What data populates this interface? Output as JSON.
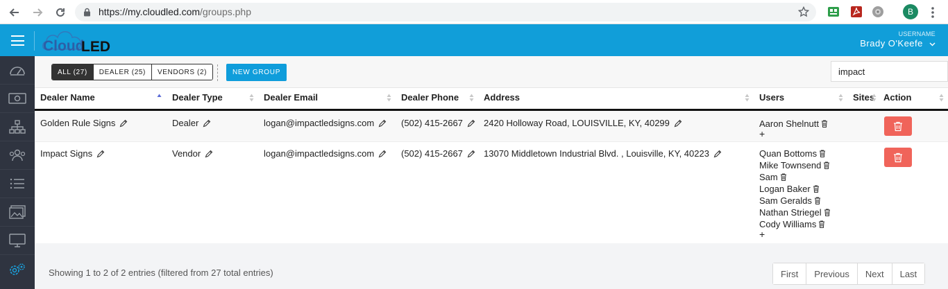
{
  "browser": {
    "url_host": "https://my.cloudled.com",
    "url_path": "/groups.php",
    "avatar_letter": "B"
  },
  "header": {
    "logo_cloud": "Cloud",
    "logo_led": "LED",
    "user_label": "USERNAME",
    "user_name": "Brady O'Keefe",
    "accent": "#119ed9"
  },
  "sidebar": {
    "items": [
      "dashboard-icon",
      "money-icon",
      "hierarchy-icon",
      "users-icon",
      "list-icon",
      "media-icon",
      "monitor-icon",
      "settings-icon"
    ]
  },
  "toolbar": {
    "filters": [
      "ALL (27)",
      "DEALER (25)",
      "VENDORS (2)"
    ],
    "new_group_label": "NEW GROUP",
    "search_value": "impact"
  },
  "table": {
    "headers": [
      "Dealer Name",
      "Dealer Type",
      "Dealer Email",
      "Dealer Phone",
      "Address",
      "Users",
      "Sites",
      "Action"
    ],
    "rows": [
      {
        "name": "Golden Rule Signs",
        "type": "Dealer",
        "email": "logan@impactledsigns.com",
        "phone": "(502) 415-2667",
        "address": "2420 Holloway Road, LOUISVILLE, KY, 40299",
        "users": [
          "Aaron Shelnutt"
        ],
        "add": "+"
      },
      {
        "name": "Impact Signs",
        "type": "Vendor",
        "email": "logan@impactledsigns.com",
        "phone": "(502) 415-2667",
        "address": "13070 Middletown Industrial Blvd. , Louisville, KY, 40223",
        "users": [
          "Quan Bottoms",
          "Mike Townsend",
          "Sam",
          "Logan Baker",
          "Sam Geralds",
          "Nathan Striegel",
          "Cody Williams"
        ],
        "add": "+"
      }
    ]
  },
  "footer": {
    "info": "Showing 1 to 2 of 2 entries (filtered from 27 total entries)",
    "pager": [
      "First",
      "Previous",
      "Next",
      "Last"
    ]
  }
}
